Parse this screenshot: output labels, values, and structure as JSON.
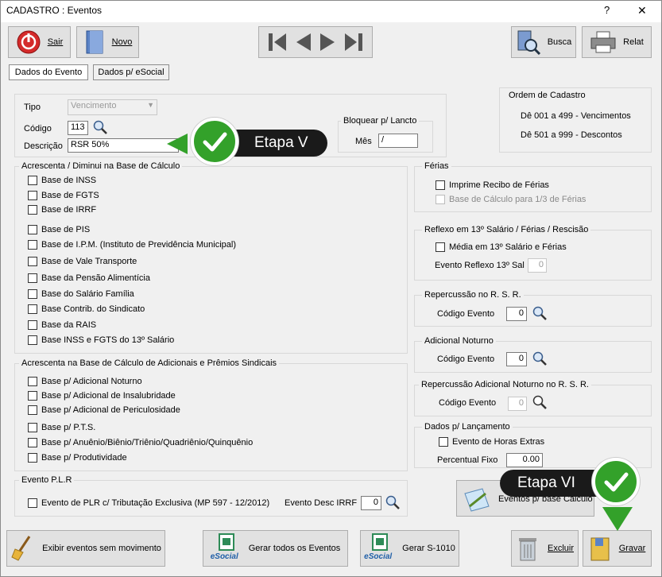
{
  "window": {
    "title": "CADASTRO : Eventos",
    "help": "?",
    "close": "✕"
  },
  "toolbar": {
    "sair": "Sair",
    "novo": "Novo",
    "busca": "Busca",
    "relat": "Relat"
  },
  "tabs": [
    "Dados do Evento",
    "Dados p/ eSocial"
  ],
  "form": {
    "tipo_label": "Tipo",
    "tipo_value": "Vencimento",
    "codigo_label": "Código",
    "codigo_value": "113",
    "descricao_label": "Descrição",
    "descricao_value": "RSR 50%"
  },
  "bloquear": {
    "title": "Bloquear p/ Lancto",
    "mes_label": "Mês",
    "mes_value": "/"
  },
  "ordem": {
    "title": "Ordem de Cadastro",
    "line1": "Dê 001 a 499 - Vencimentos",
    "line2": "Dê 501 a 999 - Descontos"
  },
  "acrescenta": {
    "title": "Acrescenta / Diminui na Base de Cálculo",
    "items": [
      "Base de INSS",
      "Base de FGTS",
      "Base de IRRF",
      "Base de PIS",
      "Base de I.P.M. (Instituto de Previdência Municipal)",
      "Base de Vale Transporte",
      "Base da Pensão Alimentícia",
      "Base do Salário Família",
      "Base Contrib. do Sindicato",
      "Base da RAIS",
      "Base INSS e FGTS do 13º Salário"
    ]
  },
  "adicionais": {
    "title": "Acrescenta na Base de Cálculo de Adicionais e Prêmios Sindicais",
    "items": [
      "Base p/ Adicional Noturno",
      "Base p/ Adicional de Insalubridade",
      "Base p/ Adicional de Periculosidade",
      "Base p/ P.T.S.",
      "Base p/ Anuênio/Biênio/Triênio/Quadriênio/Quinquênio",
      "Base p/ Produtividade"
    ]
  },
  "plr": {
    "title": "Evento P.L.R",
    "check": "Evento de PLR c/ Tributação Exclusiva (MP 597 - 12/2012)",
    "desc_label": "Evento Desc IRRF",
    "desc_value": "0"
  },
  "ferias": {
    "title": "Férias",
    "item1": "Imprime Recibo de Férias",
    "item2": "Base de Cálculo para 1/3 de Férias"
  },
  "reflexo": {
    "title": "Reflexo em 13º Salário / Férias / Rescisão",
    "item": "Média em 13º Salário e Férias",
    "evento_label": "Evento Reflexo 13º Sal",
    "evento_value": "0"
  },
  "rsr": {
    "title": "Repercussão no R. S. R.",
    "label": "Código Evento",
    "value": "0"
  },
  "noturno": {
    "title": "Adicional Noturno",
    "label": "Código Evento",
    "value": "0"
  },
  "rep_noturno": {
    "title": "Repercussão Adicional Noturno no R. S. R.",
    "label": "Código Evento",
    "value": "0"
  },
  "lancamento": {
    "title": "Dados p/ Lançamento",
    "check": "Evento de Horas Extras",
    "percentual_label": "Percentual Fixo",
    "percentual_value": "0.00"
  },
  "eventos_base": "Eventos p/ base Cálculo",
  "bottom": {
    "exibir": "Exibir eventos sem movimento",
    "gerar_todos": "Gerar todos os Eventos",
    "gerar_s1010": "Gerar S-1010",
    "esocial": "eSocial",
    "excluir": "Excluir",
    "gravar": "Gravar"
  },
  "callouts": {
    "etapa5": "Etapa V",
    "etapa6": "Etapa VI"
  },
  "colors": {
    "callout_green": "#33a12a",
    "callout_dark": "#1a1a1a",
    "esocial_green": "#2e8b57",
    "esocial_blue": "#1f5fa8"
  }
}
